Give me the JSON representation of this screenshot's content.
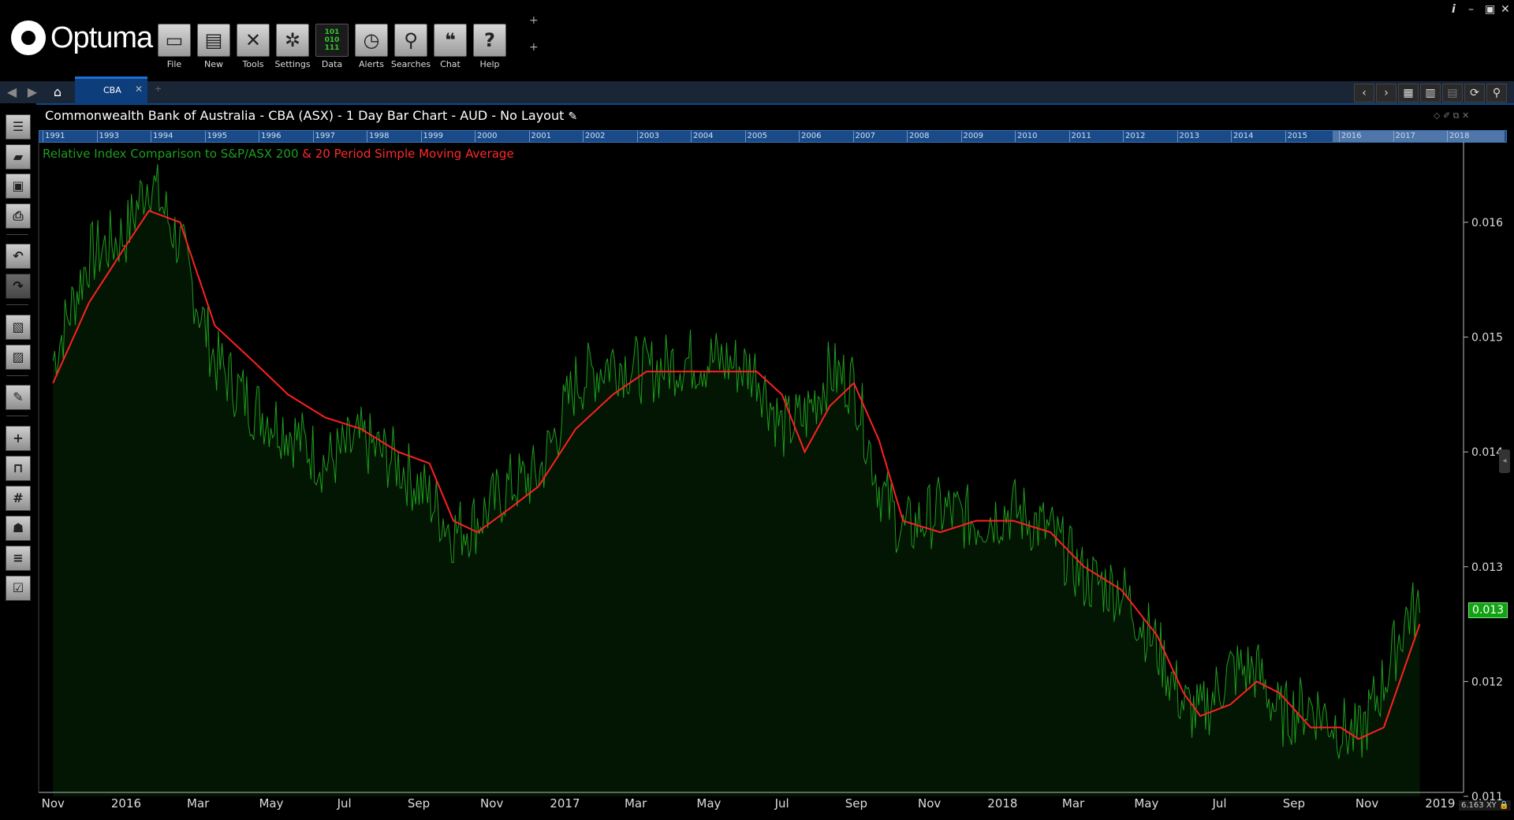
{
  "app": {
    "name": "Optuma"
  },
  "toolbar": {
    "buttons": [
      {
        "label": "File",
        "icon": "folder-icon"
      },
      {
        "label": "New",
        "icon": "new-chart-icon"
      },
      {
        "label": "Tools",
        "icon": "tools-icon"
      },
      {
        "label": "Settings",
        "icon": "gears-icon"
      },
      {
        "label": "Data",
        "icon": "binary-data-icon"
      },
      {
        "label": "Alerts",
        "icon": "alarm-clock-icon"
      },
      {
        "label": "Searches",
        "icon": "magnifier-icon"
      },
      {
        "label": "Chat",
        "icon": "chat-bubbles-icon"
      },
      {
        "label": "Help",
        "icon": "question-icon"
      }
    ]
  },
  "tabs": [
    {
      "label": "CBA"
    }
  ],
  "chart": {
    "title": "Commonwealth Bank of Australia - CBA (ASX) - 1 Day Bar Chart - AUD - No Layout",
    "legend_green": "Relative Index Comparison to S&P/ASX 200",
    "legend_red": " & 20 Period Simple Moving Average",
    "timeline_years": [
      "1991",
      "1993",
      "1994",
      "1995",
      "1996",
      "1997",
      "1998",
      "1999",
      "2000",
      "2001",
      "2002",
      "2003",
      "2004",
      "2005",
      "2006",
      "2007",
      "2008",
      "2009",
      "2010",
      "2011",
      "2012",
      "2013",
      "2014",
      "2015",
      "2016",
      "2017",
      "2018"
    ],
    "last_value": "0.013",
    "corner_readout": "6.163",
    "colors": {
      "series": "#1e9e1e",
      "sma": "#ff2020",
      "fill": "#031603",
      "label_bg": "#11a211"
    }
  },
  "chart_data": {
    "type": "area",
    "series": [
      {
        "name": "Relative Index Comparison to S&P/ASX 200",
        "x": [
          "2015-11-01",
          "2015-12-01",
          "2016-01-01",
          "2016-01-20",
          "2016-02-15",
          "2016-03-15",
          "2016-04-15",
          "2016-05-15",
          "2016-06-15",
          "2016-07-15",
          "2016-08-15",
          "2016-09-10",
          "2016-09-30",
          "2016-10-20",
          "2016-11-15",
          "2016-12-10",
          "2017-01-10",
          "2017-02-10",
          "2017-03-10",
          "2017-04-10",
          "2017-05-10",
          "2017-06-10",
          "2017-07-01",
          "2017-07-20",
          "2017-08-10",
          "2017-08-30",
          "2017-09-20",
          "2017-10-10",
          "2017-11-10",
          "2017-12-10",
          "2018-01-10",
          "2018-02-10",
          "2018-03-10",
          "2018-04-10",
          "2018-05-10",
          "2018-06-01",
          "2018-06-15",
          "2018-07-10",
          "2018-08-01",
          "2018-08-20",
          "2018-09-15",
          "2018-10-10",
          "2018-10-25",
          "2018-11-15",
          "2018-12-05",
          "2018-12-15"
        ],
        "values": [
          0.0148,
          0.0157,
          0.0159,
          0.0164,
          0.0158,
          0.0148,
          0.0144,
          0.0142,
          0.0139,
          0.0141,
          0.0139,
          0.0136,
          0.0133,
          0.0134,
          0.0137,
          0.0138,
          0.0146,
          0.0148,
          0.0147,
          0.0148,
          0.0148,
          0.0147,
          0.0142,
          0.0143,
          0.0147,
          0.0146,
          0.0137,
          0.0133,
          0.0135,
          0.0134,
          0.0135,
          0.0133,
          0.0129,
          0.0128,
          0.0123,
          0.0118,
          0.0117,
          0.0121,
          0.0121,
          0.0117,
          0.0118,
          0.0116,
          0.0115,
          0.012,
          0.0126,
          0.0126
        ]
      },
      {
        "name": "20 Period Simple Moving Average",
        "x": [
          "2015-11-01",
          "2015-12-01",
          "2016-01-01",
          "2016-01-20",
          "2016-02-15",
          "2016-03-15",
          "2016-04-15",
          "2016-05-15",
          "2016-06-15",
          "2016-07-15",
          "2016-08-15",
          "2016-09-10",
          "2016-09-30",
          "2016-10-20",
          "2016-11-15",
          "2016-12-10",
          "2017-01-10",
          "2017-02-10",
          "2017-03-10",
          "2017-04-10",
          "2017-05-10",
          "2017-06-10",
          "2017-07-01",
          "2017-07-20",
          "2017-08-10",
          "2017-08-30",
          "2017-09-20",
          "2017-10-10",
          "2017-11-10",
          "2017-12-10",
          "2018-01-10",
          "2018-02-10",
          "2018-03-10",
          "2018-04-10",
          "2018-05-10",
          "2018-06-01",
          "2018-06-15",
          "2018-07-10",
          "2018-08-01",
          "2018-08-20",
          "2018-09-15",
          "2018-10-10",
          "2018-10-25",
          "2018-11-15",
          "2018-12-05",
          "2018-12-15"
        ],
        "values": [
          0.0146,
          0.0153,
          0.0158,
          0.0161,
          0.016,
          0.0151,
          0.0148,
          0.0145,
          0.0143,
          0.0142,
          0.014,
          0.0139,
          0.0134,
          0.0133,
          0.0135,
          0.0137,
          0.0142,
          0.0145,
          0.0147,
          0.0147,
          0.0147,
          0.0147,
          0.0145,
          0.014,
          0.0144,
          0.0146,
          0.0141,
          0.0134,
          0.0133,
          0.0134,
          0.0134,
          0.0133,
          0.013,
          0.0128,
          0.0124,
          0.0119,
          0.0117,
          0.0118,
          0.012,
          0.0119,
          0.0116,
          0.0116,
          0.0115,
          0.0116,
          0.0122,
          0.0125
        ]
      }
    ],
    "x_tick_labels": [
      "Nov",
      "2016",
      "Mar",
      "May",
      "Jul",
      "Sep",
      "Nov",
      "2017",
      "Mar",
      "May",
      "Jul",
      "Sep",
      "Nov",
      "2018",
      "Mar",
      "May",
      "Jul",
      "Sep",
      "Nov",
      "2019"
    ],
    "y_tick_labels": [
      "0.016",
      "0.015",
      "0.014",
      "0.013",
      "0.012",
      "0.011"
    ],
    "ylim": [
      0.011,
      0.0167
    ],
    "grid": false
  }
}
